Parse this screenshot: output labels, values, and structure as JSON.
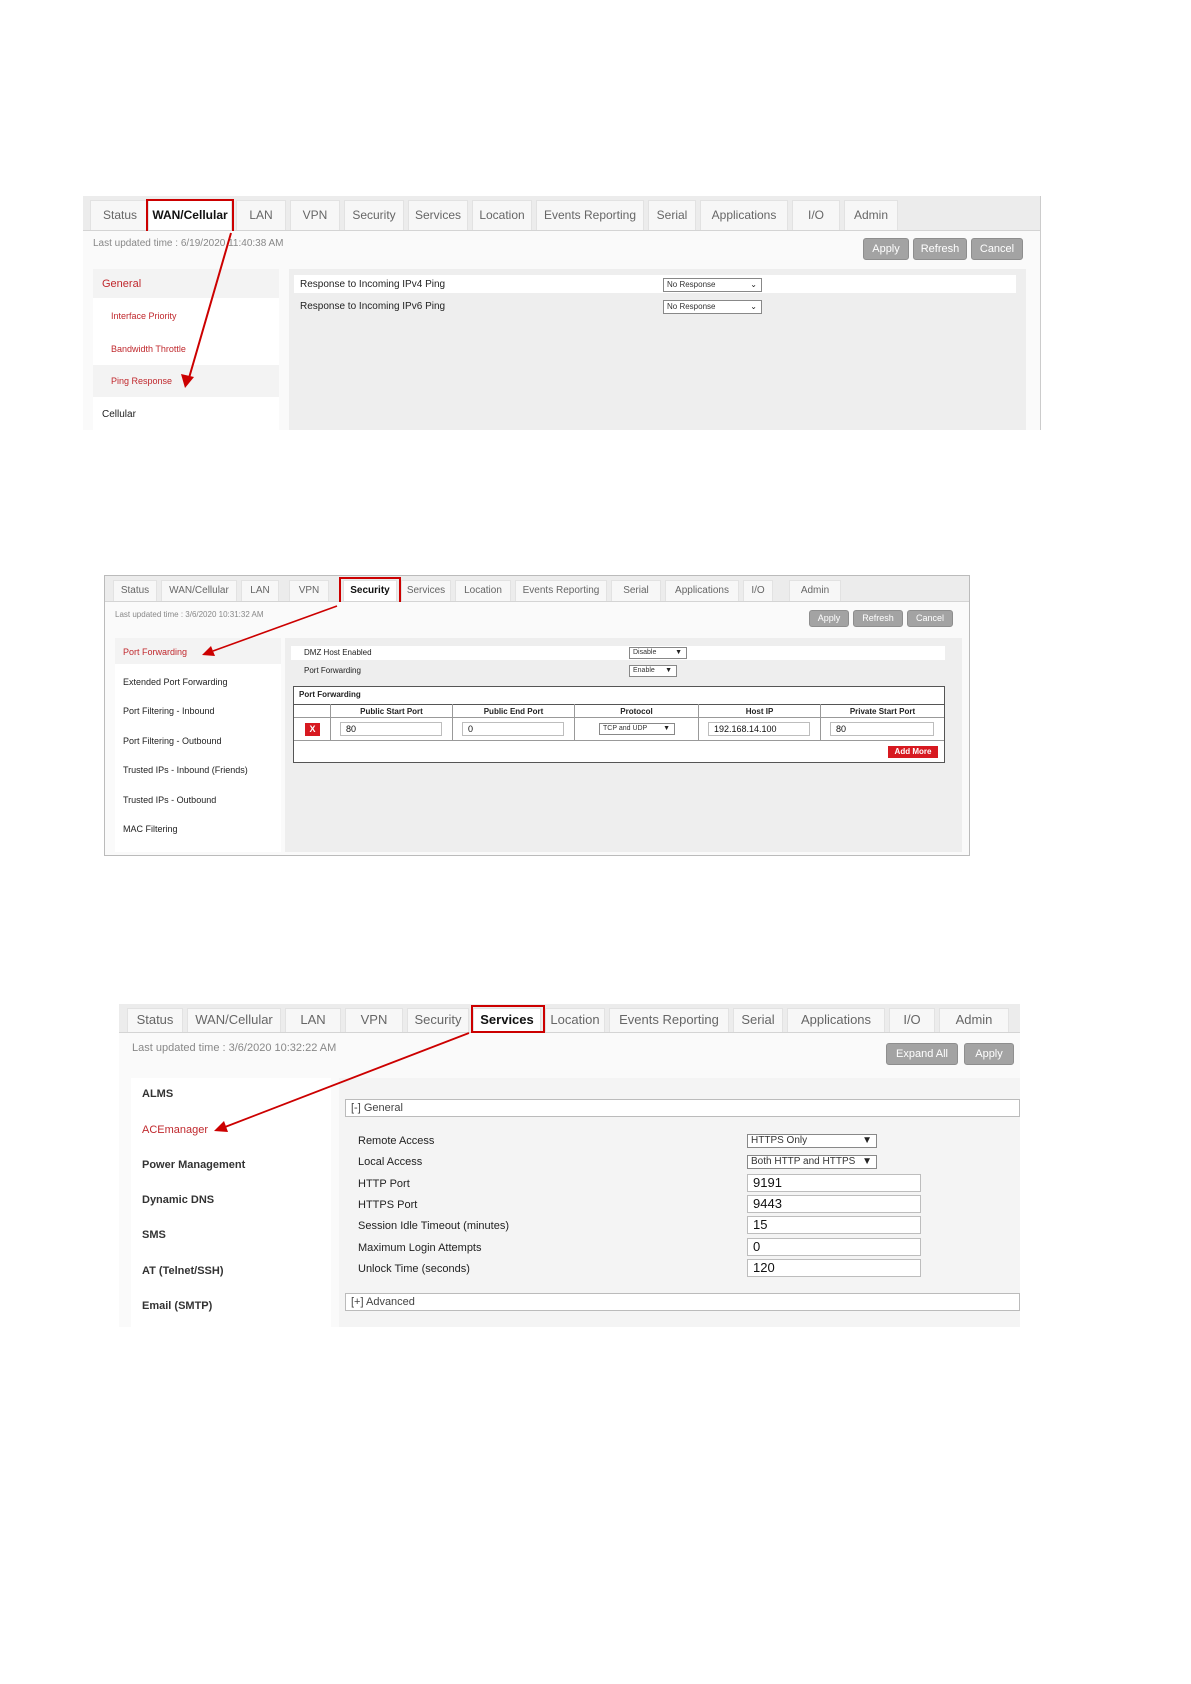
{
  "colors": {
    "highlight": "#c00000",
    "accent_red": "#d71920",
    "nav_red": "#c0282d",
    "button_gray": "#a3a3a3"
  },
  "shot1": {
    "tabs": [
      "Status",
      "WAN/Cellular",
      "LAN",
      "VPN",
      "Security",
      "Services",
      "Location",
      "Events Reporting",
      "Serial",
      "Applications",
      "I/O",
      "Admin"
    ],
    "active_tab": "WAN/Cellular",
    "last_updated": "Last updated time : 6/19/2020 11:40:38 AM",
    "buttons": {
      "apply": "Apply",
      "refresh": "Refresh",
      "cancel": "Cancel"
    },
    "nav": {
      "general": "General",
      "interface_priority": "Interface Priority",
      "bandwidth_throttle": "Bandwidth Throttle",
      "ping_response": "Ping Response",
      "cellular": "Cellular"
    },
    "rows": [
      {
        "label": "Response to Incoming IPv4 Ping",
        "value": "No Response"
      },
      {
        "label": "Response to Incoming IPv6 Ping",
        "value": "No Response"
      }
    ]
  },
  "shot2": {
    "tabs": [
      "Status",
      "WAN/Cellular",
      "LAN",
      "VPN",
      "Security",
      "Services",
      "Location",
      "Events Reporting",
      "Serial",
      "Applications",
      "I/O",
      "Admin"
    ],
    "active_tab": "Security",
    "last_updated": "Last updated time : 3/6/2020 10:31:32 AM",
    "buttons": {
      "apply": "Apply",
      "refresh": "Refresh",
      "cancel": "Cancel"
    },
    "nav": [
      "Port Forwarding",
      "Extended Port Forwarding",
      "Port Filtering - Inbound",
      "Port Filtering - Outbound",
      "Trusted IPs - Inbound (Friends)",
      "Trusted IPs - Outbound",
      "MAC Filtering"
    ],
    "settings": [
      {
        "label": "DMZ Host Enabled",
        "value": "Disable"
      },
      {
        "label": "Port Forwarding",
        "value": "Enable"
      }
    ],
    "table": {
      "title": "Port Forwarding",
      "headers": [
        "Public Start Port",
        "Public End Port",
        "Protocol",
        "Host IP",
        "Private Start Port"
      ],
      "row": {
        "delete": "X",
        "public_start": "80",
        "public_end": "0",
        "protocol": "TCP and UDP",
        "host_ip": "192.168.14.100",
        "private_start": "80"
      },
      "add_more": "Add More"
    }
  },
  "shot3": {
    "tabs": [
      "Status",
      "WAN/Cellular",
      "LAN",
      "VPN",
      "Security",
      "Services",
      "Location",
      "Events Reporting",
      "Serial",
      "Applications",
      "I/O",
      "Admin"
    ],
    "active_tab": "Services",
    "last_updated": "Last updated time : 3/6/2020 10:32:22 AM",
    "buttons": {
      "expand_all": "Expand All",
      "apply": "Apply"
    },
    "nav": [
      "ALMS",
      "ACEmanager",
      "Power Management",
      "Dynamic DNS",
      "SMS",
      "AT (Telnet/SSH)",
      "Email (SMTP)"
    ],
    "general_header": "[-] General",
    "advanced_header": "[+] Advanced",
    "fields": [
      {
        "label": "Remote Access",
        "value": "HTTPS Only"
      },
      {
        "label": "Local Access",
        "value": "Both HTTP and HTTPS"
      },
      {
        "label": "HTTP Port",
        "value": "9191"
      },
      {
        "label": "HTTPS Port",
        "value": "9443"
      },
      {
        "label": "Session Idle Timeout (minutes)",
        "value": "15"
      },
      {
        "label": "Maximum Login Attempts",
        "value": "0"
      },
      {
        "label": "Unlock Time (seconds)",
        "value": "120"
      }
    ]
  }
}
